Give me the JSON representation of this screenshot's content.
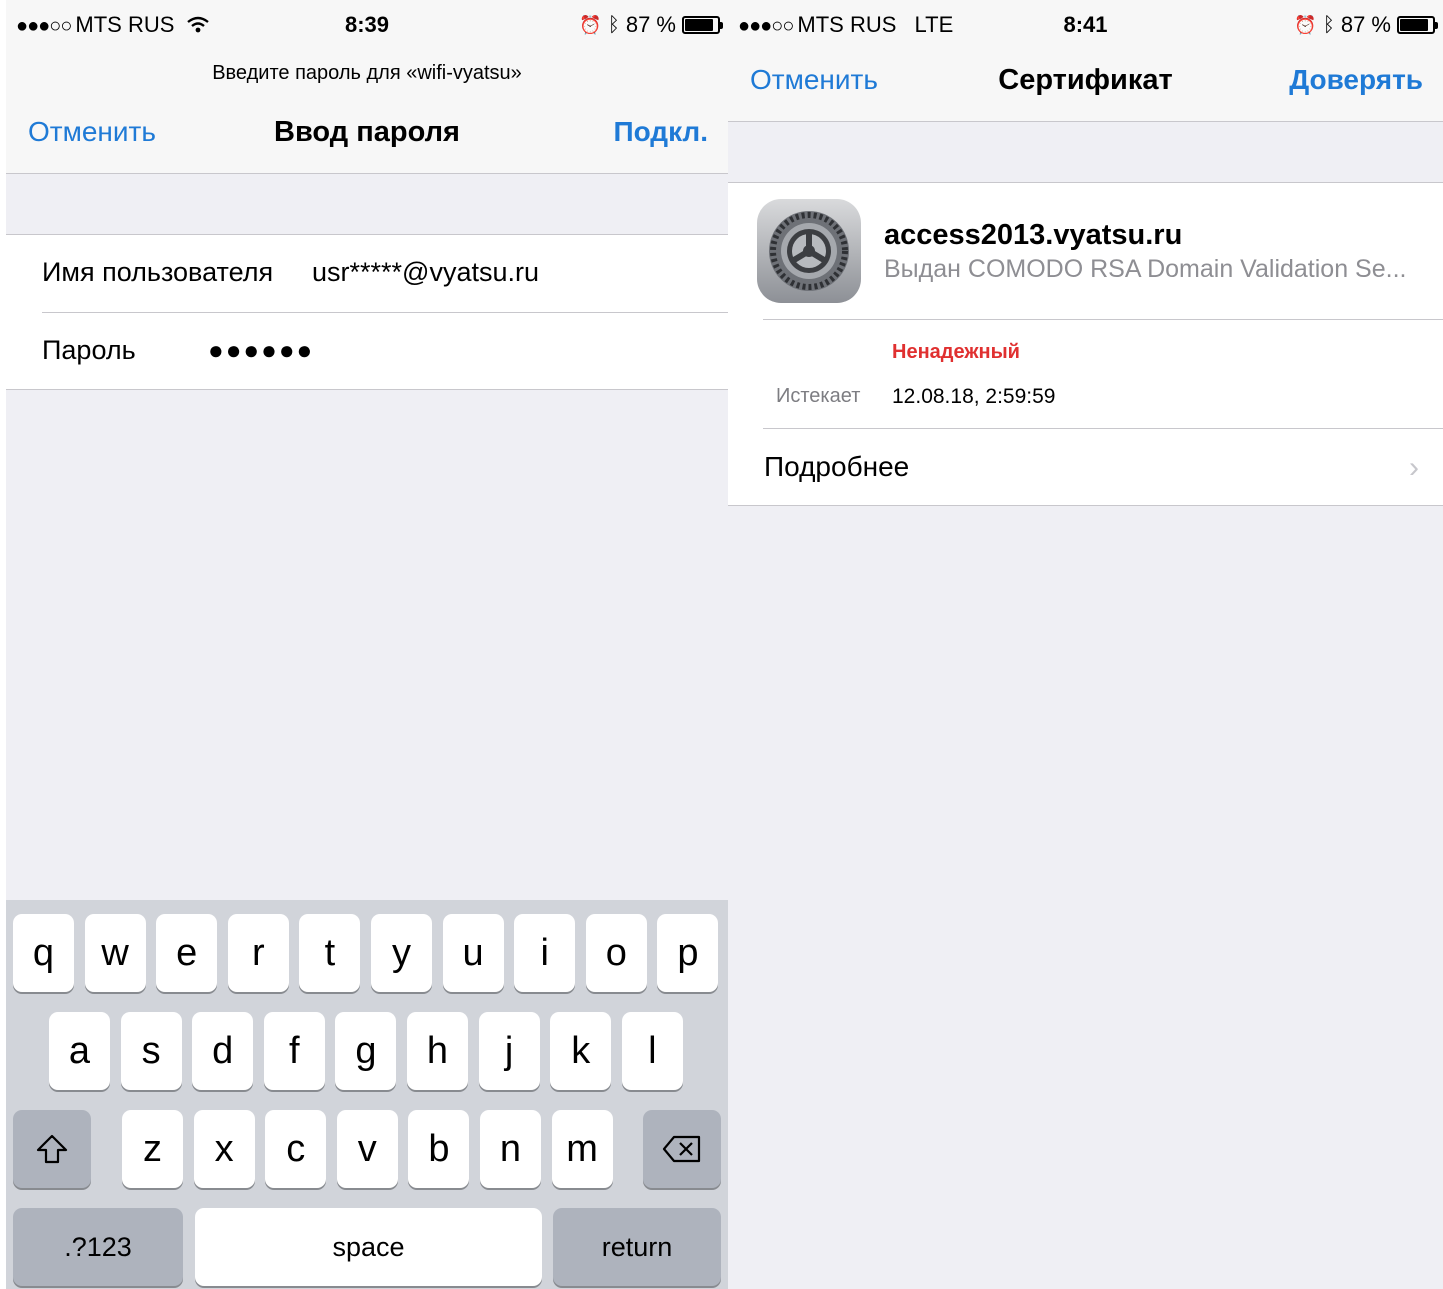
{
  "left_screen": {
    "status": {
      "carrier": "MTS RUS",
      "signal_dots": "●●●○○",
      "time": "8:39",
      "battery": "87 %",
      "battery_level": 0.87
    },
    "nav": {
      "prompt": "Введите пароль для «wifi-vyatsu»",
      "cancel": "Отменить",
      "title": "Ввод пароля",
      "connect": "Подкл."
    },
    "form": {
      "username_label": "Имя пользователя",
      "username_value": "usr*****@vyatsu.ru",
      "password_label": "Пароль",
      "password_value": "●●●●●●"
    },
    "keyboard": {
      "row1": [
        "q",
        "w",
        "e",
        "r",
        "t",
        "y",
        "u",
        "i",
        "o",
        "p"
      ],
      "row2": [
        "a",
        "s",
        "d",
        "f",
        "g",
        "h",
        "j",
        "k",
        "l"
      ],
      "row3": [
        "z",
        "x",
        "c",
        "v",
        "b",
        "n",
        "m"
      ],
      "numbers_key": ".?123",
      "space_key": "space",
      "return_key": "return"
    }
  },
  "right_screen": {
    "status": {
      "carrier": "MTS RUS",
      "signal_dots": "●●●○○",
      "network": "LTE",
      "time": "8:41",
      "battery": "87 %",
      "battery_level": 0.87
    },
    "nav": {
      "cancel": "Отменить",
      "title": "Сертификат",
      "trust": "Доверять"
    },
    "certificate": {
      "domain": "access2013.vyatsu.ru",
      "issued_by": "Выдан COMODO RSA Domain Validation Se...",
      "trust_status": "Ненадежный",
      "expires_label": "Истекает",
      "expires_value": "12.08.18, 2:59:59",
      "more_label": "Подробнее"
    }
  },
  "colors": {
    "accent": "#1f7ad6",
    "warning": "#e03030",
    "background": "#efeff4",
    "keyboard": "#d1d4da"
  }
}
